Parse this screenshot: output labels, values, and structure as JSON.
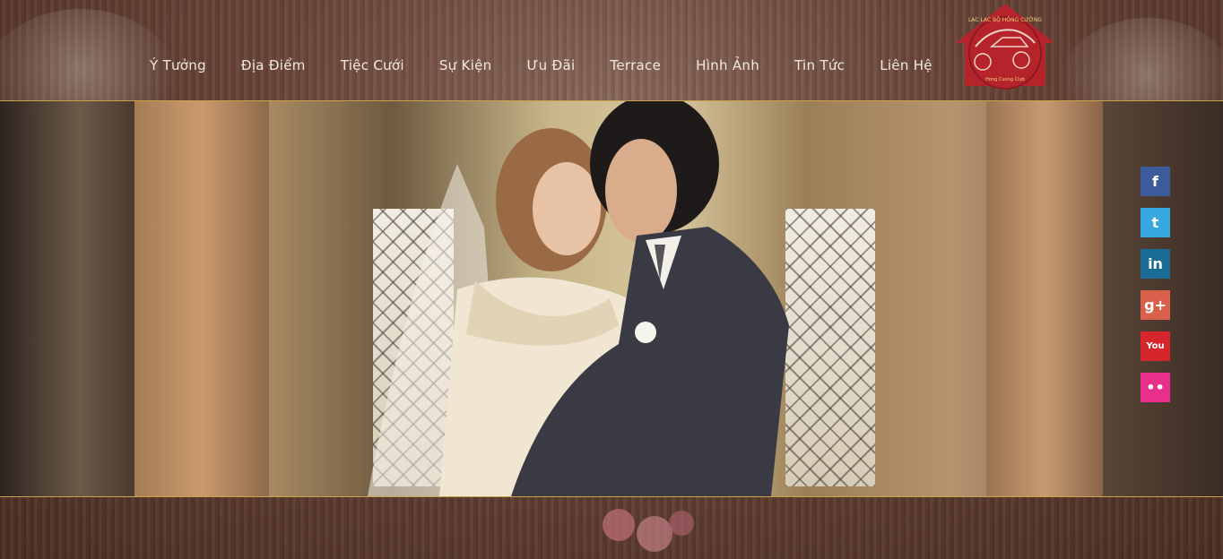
{
  "nav": {
    "items": [
      "Ý Tưởng",
      "Địa Điểm",
      "Tiệc Cưới",
      "Sự Kiện",
      "Ưu Đãi",
      "Terrace",
      "Hình Ảnh",
      "Tin Tức",
      "Liên Hệ"
    ]
  },
  "logo": {
    "brand": "LẠC LẠC BỘ HỒNG CƯỜNG",
    "sub": "Hong Cuong Club"
  },
  "social": {
    "facebook": "f",
    "twitter": "t",
    "linkedin": "in",
    "googleplus": "g+",
    "youtube": "You",
    "flickr": "••"
  },
  "colors": {
    "accent_line": "#c9a24a",
    "logo_red": "#b5232b",
    "nav_text": "#f2e8e2"
  }
}
